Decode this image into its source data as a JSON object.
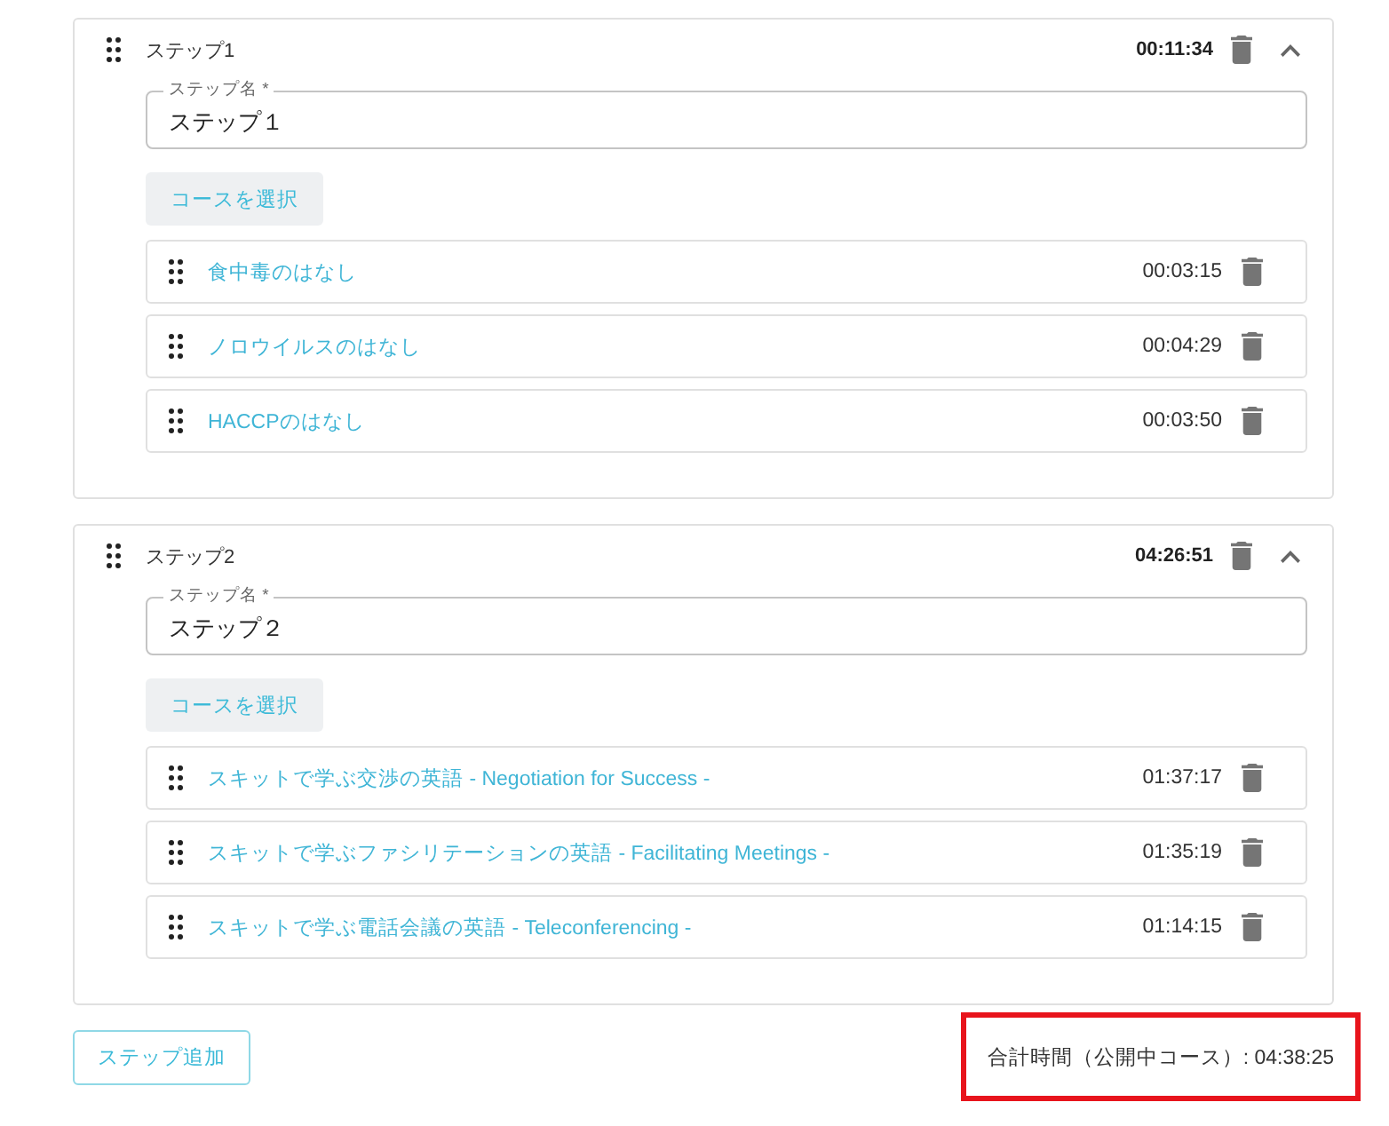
{
  "steps": [
    {
      "title": "ステップ1",
      "duration": "00:11:34",
      "expanded": true,
      "name_field": {
        "label": "ステップ名 *",
        "value": "ステップ１"
      },
      "select_button": "コースを選択",
      "courses": [
        {
          "title": "食中毒のはなし",
          "duration": "00:03:15"
        },
        {
          "title": "ノロウイルスのはなし",
          "duration": "00:04:29"
        },
        {
          "title": "HACCPのはなし",
          "duration": "00:03:50"
        }
      ]
    },
    {
      "title": "ステップ2",
      "duration": "04:26:51",
      "expanded": true,
      "name_field": {
        "label": "ステップ名 *",
        "value": "ステップ２"
      },
      "select_button": "コースを選択",
      "courses": [
        {
          "title": "スキットで学ぶ交渉の英語 - Negotiation for Success -",
          "duration": "01:37:17"
        },
        {
          "title": "スキットで学ぶファシリテーションの英語 - Facilitating Meetings -",
          "duration": "01:35:19"
        },
        {
          "title": "スキットで学ぶ電話会議の英語 - Teleconferencing -",
          "duration": "01:14:15"
        }
      ]
    }
  ],
  "add_step_button": "ステップ追加",
  "total": {
    "text": "合計時間（公開中コース）: 04:38:25",
    "highlighted": true
  }
}
